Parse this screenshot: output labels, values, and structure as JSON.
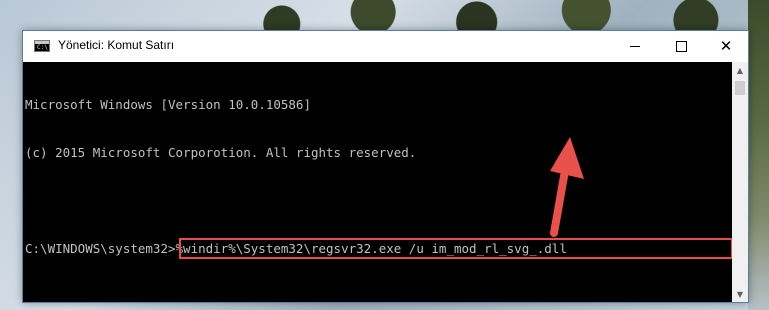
{
  "window": {
    "title": "Yönetici: Komut Satırı",
    "icon": "cmd-icon",
    "icon_text": "C:\\"
  },
  "console": {
    "lines": [
      "Microsoft Windows [Version 10.0.10586]",
      "(c) 2015 Microsoft Corporotion. All rights reserved."
    ],
    "prompt": "C:\\WINDOWS\\system32>",
    "command": "%windir%\\System32\\regsvr32.exe /u im_mod_rl_svg_.dll"
  },
  "colors": {
    "highlight": "#e84b4b",
    "arrow": "#e8504c",
    "console_bg": "#000000",
    "console_text": "#c0c0c0"
  }
}
